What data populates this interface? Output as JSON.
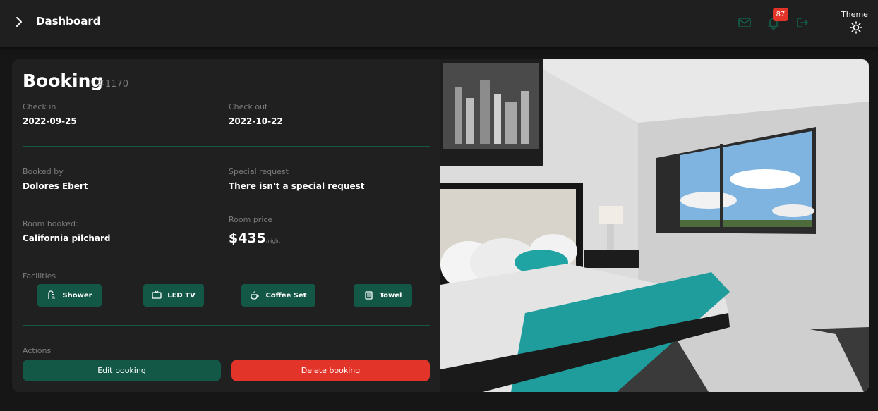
{
  "header": {
    "title": "Dashboard",
    "notification_count": "87",
    "theme_label": "Theme",
    "icons": [
      "chevron-right-icon",
      "mail-icon",
      "bell-icon",
      "logout-icon",
      "sun-icon"
    ]
  },
  "booking": {
    "heading": "Booking",
    "id": "#1170",
    "check_in_label": "Check in",
    "check_in": "2022-09-25",
    "check_out_label": "Check out",
    "check_out": "2022-10-22",
    "booked_by_label": "Booked by",
    "booked_by": "Dolores Ebert",
    "special_request_label": "Special request",
    "special_request": "There isn't a special request",
    "room_booked_label": "Room booked:",
    "room_booked": "California pilchard",
    "room_price_label": "Room price",
    "room_price": "$435",
    "price_unit": "/night",
    "facilities_label": "Facilities",
    "facilities": [
      {
        "label": "Shower",
        "icon": "shower-icon"
      },
      {
        "label": "LED TV",
        "icon": "tv-icon"
      },
      {
        "label": "Coffee Set",
        "icon": "coffee-icon"
      },
      {
        "label": "Towel",
        "icon": "towel-icon"
      }
    ],
    "actions_label": "Actions",
    "edit_button": "Edit booking",
    "delete_button": "Delete booking"
  },
  "colors": {
    "accent": "#135846",
    "danger": "#e23428",
    "background": "#161616",
    "panel": "#202020"
  }
}
